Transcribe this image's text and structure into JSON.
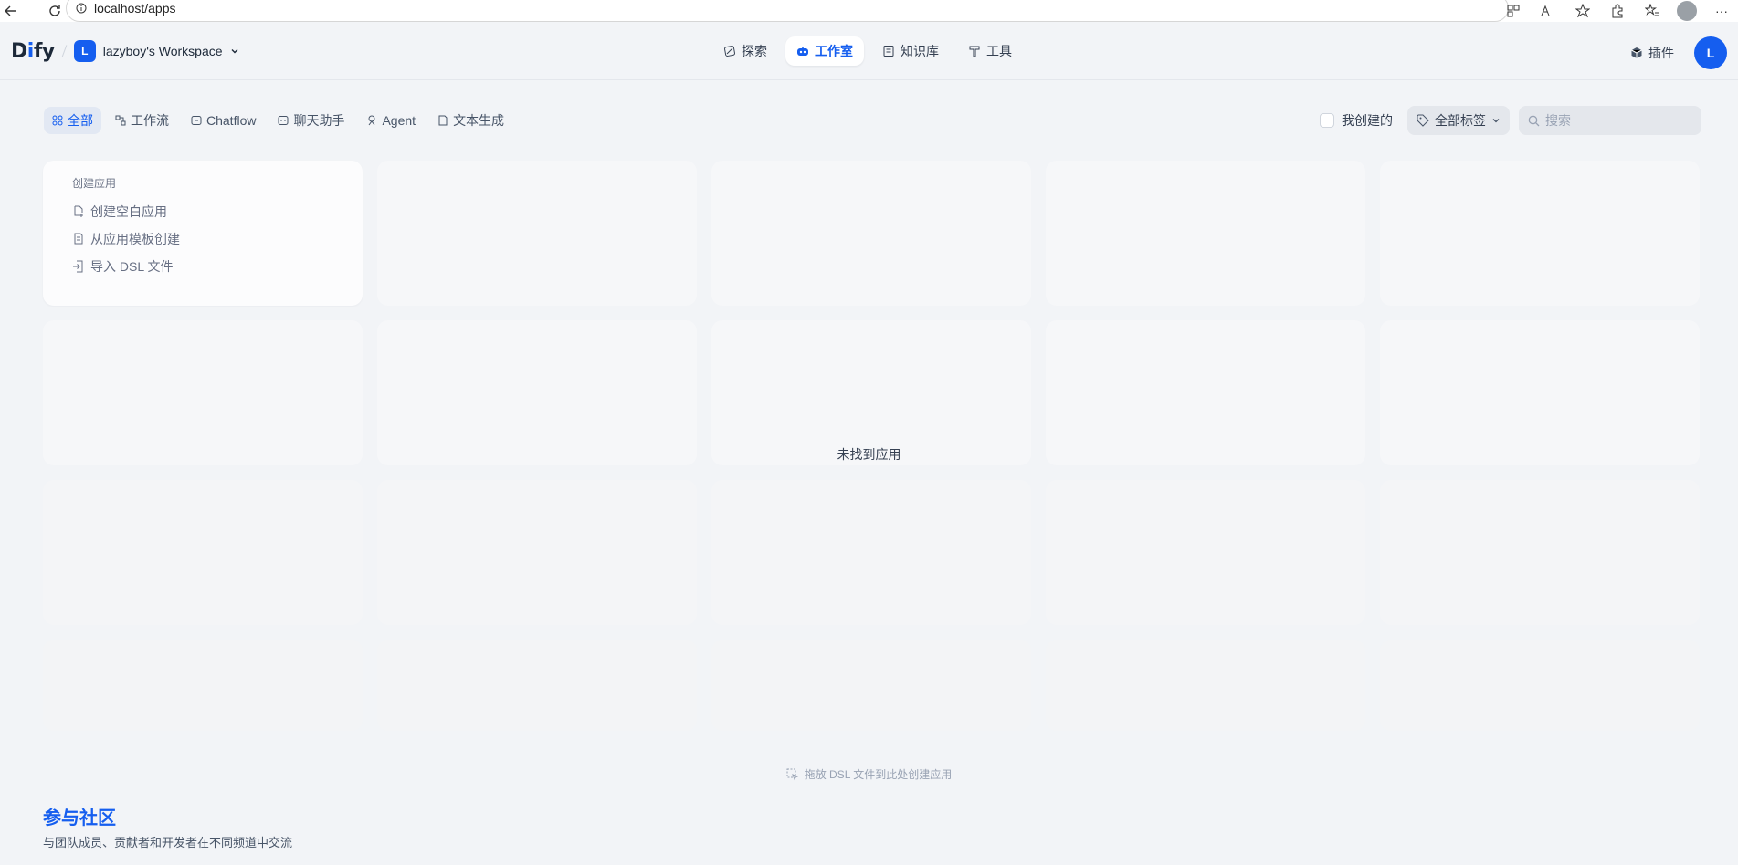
{
  "browser": {
    "url": "localhost/apps"
  },
  "header": {
    "logo": "Dify",
    "workspace_initial": "L",
    "workspace_name": "lazyboy's Workspace",
    "nav": [
      {
        "label": "探索",
        "icon": "compass-icon"
      },
      {
        "label": "工作室",
        "icon": "robot-icon"
      },
      {
        "label": "知识库",
        "icon": "book-icon"
      },
      {
        "label": "工具",
        "icon": "hammer-icon"
      }
    ],
    "plugin_label": "插件",
    "user_initial": "L"
  },
  "filters": {
    "tabs": [
      {
        "label": "全部",
        "icon": "grid-icon"
      },
      {
        "label": "工作流",
        "icon": "workflow-icon"
      },
      {
        "label": "Chatflow",
        "icon": "chatflow-icon"
      },
      {
        "label": "聊天助手",
        "icon": "chat-icon"
      },
      {
        "label": "Agent",
        "icon": "agent-icon"
      },
      {
        "label": "文本生成",
        "icon": "document-icon"
      }
    ],
    "created_by_me": "我创建的",
    "tag_select": "全部标签",
    "search_placeholder": "搜索"
  },
  "create_card": {
    "title": "创建应用",
    "items": [
      {
        "label": "创建空白应用",
        "icon": "file-plus-icon"
      },
      {
        "label": "从应用模板创建",
        "icon": "template-icon"
      },
      {
        "label": "导入 DSL 文件",
        "icon": "import-icon"
      }
    ]
  },
  "empty_text": "未找到应用",
  "drop_hint": "拖放 DSL 文件到此处创建应用",
  "community": {
    "title": "参与社区",
    "description": "与团队成员、贡献者和开发者在不同频道中交流"
  }
}
